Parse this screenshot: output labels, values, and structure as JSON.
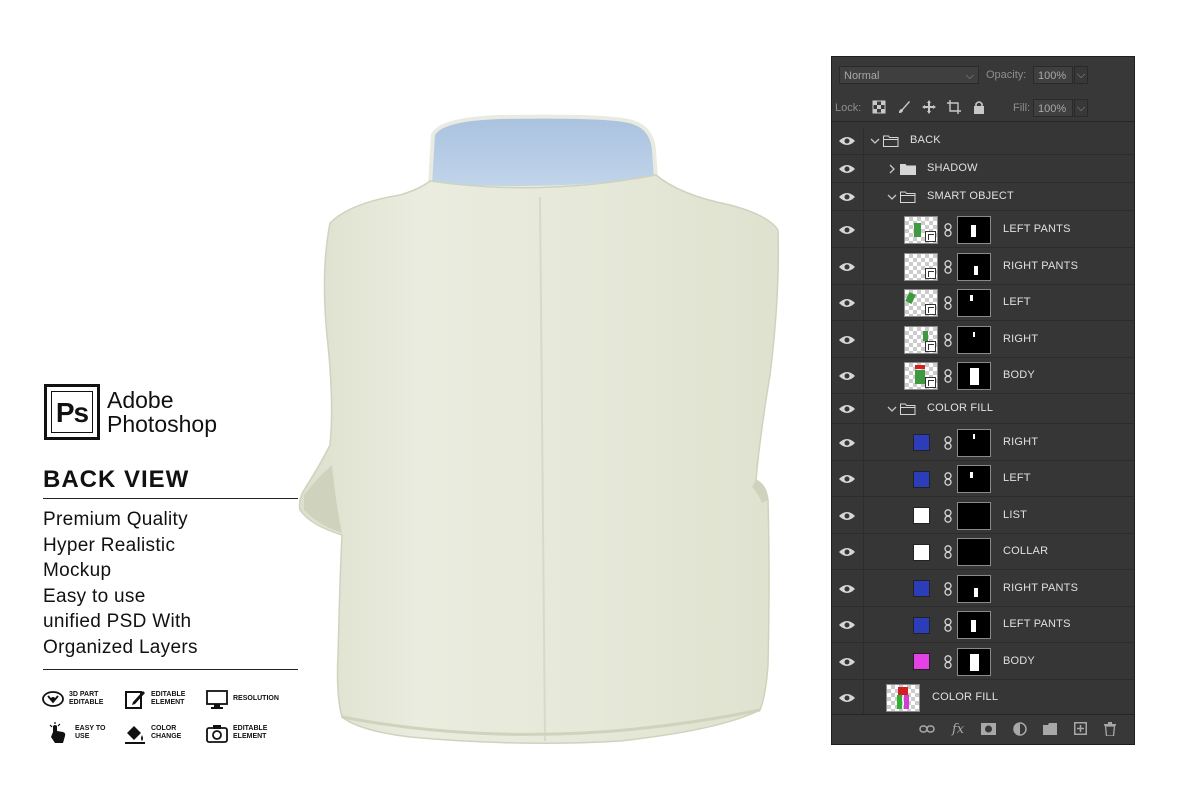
{
  "branding": {
    "logo_text": "Ps",
    "brand_line1": "Adobe",
    "brand_line2": "Photoshop",
    "view_title": "BACK VIEW",
    "features": [
      "Premium Quality",
      "Hyper Realistic",
      "Mockup",
      "Easy to use",
      "unified PSD With",
      "Organized Layers"
    ],
    "badges": [
      {
        "icon": "3d-part-icon",
        "label": "3D PART EDITABLE"
      },
      {
        "icon": "edit-icon",
        "label": "EDITABLE ELEMENT"
      },
      {
        "icon": "monitor-icon",
        "label": "RESOLUTION"
      },
      {
        "icon": "hand-touch-icon",
        "label": "EASY TO USE"
      },
      {
        "icon": "paint-bucket-icon",
        "label": "COLOR CHANGE"
      },
      {
        "icon": "camera-icon",
        "label": "EDITABLE ELEMENT"
      }
    ]
  },
  "panel": {
    "blend_mode": "Normal",
    "opacity_label": "Opacity:",
    "opacity_value": "100%",
    "lock_label": "Lock:",
    "fill_label": "Fill:",
    "fill_value": "100%",
    "layers": [
      {
        "name": "BACK",
        "kind": "group",
        "expanded": true
      },
      {
        "name": "SHADOW",
        "kind": "group",
        "expanded": false
      },
      {
        "name": "SMART OBJECT",
        "kind": "group",
        "expanded": true
      },
      {
        "name": "LEFT PANTS",
        "kind": "smart"
      },
      {
        "name": "RIGHT PANTS",
        "kind": "smart"
      },
      {
        "name": "LEFT",
        "kind": "smart"
      },
      {
        "name": "RIGHT",
        "kind": "smart"
      },
      {
        "name": "BODY",
        "kind": "smart"
      },
      {
        "name": "COLOR FILL",
        "kind": "group",
        "expanded": true
      },
      {
        "name": "RIGHT",
        "kind": "fill",
        "color": "#2b3db8"
      },
      {
        "name": "LEFT",
        "kind": "fill",
        "color": "#2b3db8"
      },
      {
        "name": "LIST",
        "kind": "fill",
        "color": "#ffffff"
      },
      {
        "name": "COLLAR",
        "kind": "fill",
        "color": "#ffffff"
      },
      {
        "name": "RIGHT PANTS",
        "kind": "fill",
        "color": "#2b3db8"
      },
      {
        "name": "LEFT PANTS",
        "kind": "fill",
        "color": "#2b3db8"
      },
      {
        "name": "BODY",
        "kind": "fill",
        "color": "#e442e4"
      },
      {
        "name": "COLOR FILL",
        "kind": "image"
      }
    ],
    "bottom_icons": [
      "link-icon",
      "fx-icon",
      "mask-icon",
      "adjustment-icon",
      "new-group-icon",
      "new-layer-icon",
      "trash-icon"
    ],
    "bottom_fx_label": "fx"
  },
  "colors": {
    "vest_body": "#e8eadc",
    "vest_collar": "#b7cde6",
    "panel_bg": "#363636"
  }
}
